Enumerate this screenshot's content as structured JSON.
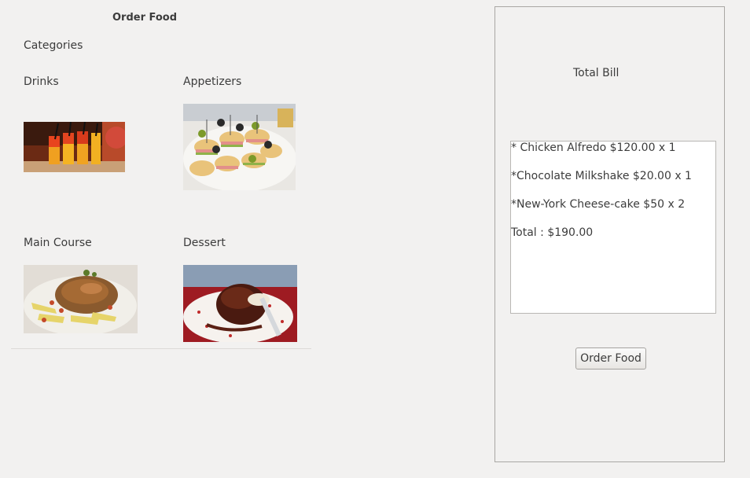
{
  "header": {
    "title": "Order Food"
  },
  "menu": {
    "section_label": "Categories",
    "categories": [
      {
        "label": "Drinks",
        "image": "drinks-photo"
      },
      {
        "label": "Appetizers",
        "image": "appetizers-photo"
      },
      {
        "label": "Main Course",
        "image": "main-course-photo"
      },
      {
        "label": "Dessert",
        "image": "dessert-photo"
      }
    ]
  },
  "bill": {
    "title": "Total Bill",
    "lines": [
      "* Chicken Alfredo $120.00 x 1",
      "*Chocolate Milkshake $20.00 x 1",
      "*New-York Cheese-cake $50 x 2",
      "Total : $190.00"
    ],
    "order_button": "Order Food"
  }
}
